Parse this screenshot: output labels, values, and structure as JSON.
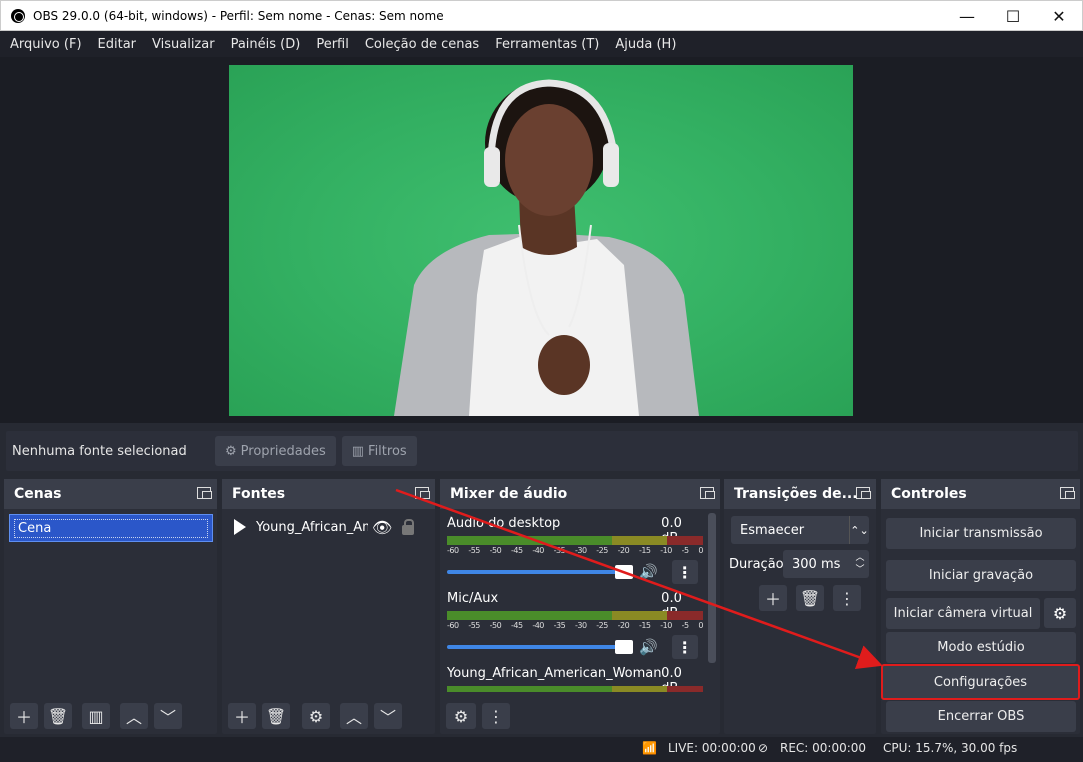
{
  "window": {
    "title": "OBS 29.0.0 (64-bit, windows) - Perfil: Sem nome - Cenas: Sem nome",
    "minimize": "—",
    "maximize": "☐",
    "close": "✕"
  },
  "menu": [
    "Arquivo (F)",
    "Editar",
    "Visualizar",
    "Painéis (D)",
    "Perfil",
    "Coleção de cenas",
    "Ferramentas (T)",
    "Ajuda (H)"
  ],
  "source_toolbar": {
    "no_source": "Nenhuma fonte selecionad",
    "properties": "Propriedades",
    "filters": "Filtros"
  },
  "scenes": {
    "title": "Cenas",
    "items": [
      "Cena"
    ]
  },
  "sources": {
    "title": "Fontes",
    "items": [
      "Young_African_Am"
    ]
  },
  "mixer": {
    "title": "Mixer de áudio",
    "ticks": [
      "-60",
      "-55",
      "-50",
      "-45",
      "-40",
      "-35",
      "-30",
      "-25",
      "-20",
      "-15",
      "-10",
      "-5",
      "0"
    ],
    "channels": [
      {
        "name": "Áudio do desktop",
        "level": "0.0 dB"
      },
      {
        "name": "Mic/Aux",
        "level": "0.0 dB"
      },
      {
        "name": "Young_African_American_Woman_He",
        "level": "0.0 dB"
      }
    ]
  },
  "transitions": {
    "title": "Transições de...",
    "selected": "Esmaecer",
    "duration_label": "Duração",
    "duration_value": "300 ms"
  },
  "controls": {
    "title": "Controles",
    "start_stream": "Iniciar transmissão",
    "start_record": "Iniciar gravação",
    "start_virtualcam": "Iniciar câmera virtual",
    "studio_mode": "Modo estúdio",
    "settings": "Configurações",
    "exit": "Encerrar OBS"
  },
  "status": {
    "live": "LIVE: 00:00:00",
    "rec": "REC: 00:00:00",
    "cpu": "CPU: 15.7%, 30.00 fps"
  },
  "colors": {
    "accent_highlight": "#e01c1c",
    "selection": "#2b57c9",
    "preview_bg": "#33b062"
  }
}
